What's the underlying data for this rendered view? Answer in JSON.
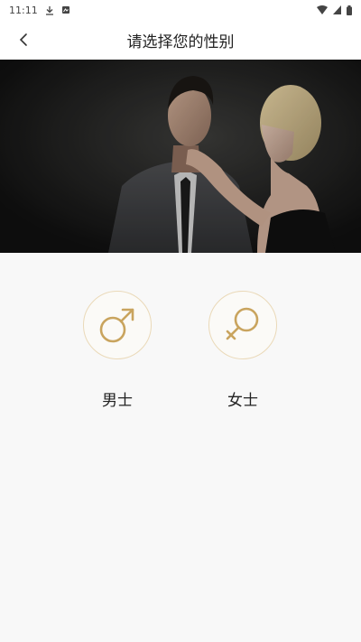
{
  "status_bar": {
    "time": "11:11"
  },
  "app_bar": {
    "title": "请选择您的性别"
  },
  "hero": {
    "alt": "couple-photo"
  },
  "options": [
    {
      "label": "男士",
      "icon": "male-symbol-icon"
    },
    {
      "label": "女士",
      "icon": "female-symbol-icon"
    }
  ],
  "colors": {
    "accent": "#c9a45e",
    "background": "#f8f8f8"
  }
}
